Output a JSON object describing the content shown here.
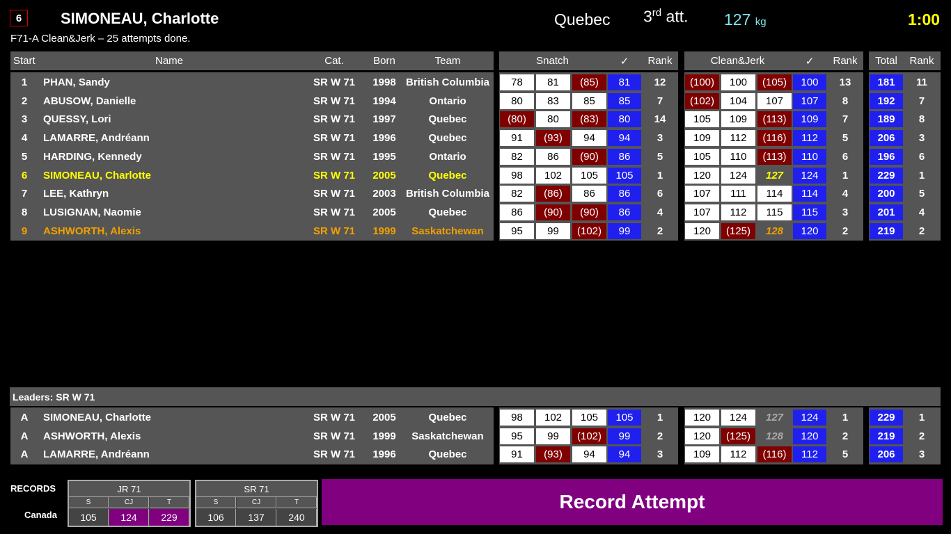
{
  "header": {
    "start_number": "6",
    "athlete_name": "SIMONEAU, Charlotte",
    "group_info": "F71-A Clean&Jerk – 25 attempts done.",
    "team": "Quebec",
    "attempt_number": "3",
    "attempt_suffix": "rd",
    "attempt_label": "att.",
    "requested_weight": "127",
    "weight_unit": "kg",
    "clock": "1:00"
  },
  "columns": {
    "start": "Start",
    "name": "Name",
    "category": "Cat.",
    "born": "Born",
    "team": "Team",
    "snatch": "Snatch",
    "best_mark": "✓",
    "rank": "Rank",
    "clean_jerk": "Clean&Jerk",
    "total": "Total"
  },
  "colors": {
    "good": "#ffffff",
    "fail": "#800000",
    "best": "#2020ee",
    "current": "#ffff00",
    "next": "#f0a000",
    "record": "#800080"
  },
  "athletes": [
    {
      "start": "1",
      "name": "PHAN, Sandy",
      "cat": "SR W 71",
      "born": "1998",
      "team": "British Columbia",
      "sn": [
        [
          "78",
          "good"
        ],
        [
          "81",
          "good"
        ],
        [
          "(85)",
          "fail"
        ]
      ],
      "sn_best": "81",
      "sn_rank": "12",
      "cj": [
        [
          "(100)",
          "fail"
        ],
        [
          "100",
          "good"
        ],
        [
          "(105)",
          "fail"
        ]
      ],
      "cj_best": "100",
      "cj_rank": "13",
      "total": "181",
      "total_rank": "11",
      "hl": ""
    },
    {
      "start": "2",
      "name": "ABUSOW, Danielle",
      "cat": "SR W 71",
      "born": "1994",
      "team": "Ontario",
      "sn": [
        [
          "80",
          "good"
        ],
        [
          "83",
          "good"
        ],
        [
          "85",
          "good"
        ]
      ],
      "sn_best": "85",
      "sn_rank": "7",
      "cj": [
        [
          "(102)",
          "fail"
        ],
        [
          "104",
          "good"
        ],
        [
          "107",
          "good"
        ]
      ],
      "cj_best": "107",
      "cj_rank": "8",
      "total": "192",
      "total_rank": "7",
      "hl": ""
    },
    {
      "start": "3",
      "name": "QUESSY, Lori",
      "cat": "SR W 71",
      "born": "1997",
      "team": "Quebec",
      "sn": [
        [
          "(80)",
          "fail"
        ],
        [
          "80",
          "good"
        ],
        [
          "(83)",
          "fail"
        ]
      ],
      "sn_best": "80",
      "sn_rank": "14",
      "cj": [
        [
          "105",
          "good"
        ],
        [
          "109",
          "good"
        ],
        [
          "(113)",
          "fail"
        ]
      ],
      "cj_best": "109",
      "cj_rank": "7",
      "total": "189",
      "total_rank": "8",
      "hl": ""
    },
    {
      "start": "4",
      "name": "LAMARRE, Andréann",
      "cat": "SR W 71",
      "born": "1996",
      "team": "Quebec",
      "sn": [
        [
          "91",
          "good"
        ],
        [
          "(93)",
          "fail"
        ],
        [
          "94",
          "good"
        ]
      ],
      "sn_best": "94",
      "sn_rank": "3",
      "cj": [
        [
          "109",
          "good"
        ],
        [
          "112",
          "good"
        ],
        [
          "(116)",
          "fail"
        ]
      ],
      "cj_best": "112",
      "cj_rank": "5",
      "total": "206",
      "total_rank": "3",
      "hl": ""
    },
    {
      "start": "5",
      "name": "HARDING, Kennedy",
      "cat": "SR W 71",
      "born": "1995",
      "team": "Ontario",
      "sn": [
        [
          "82",
          "good"
        ],
        [
          "86",
          "good"
        ],
        [
          "(90)",
          "fail"
        ]
      ],
      "sn_best": "86",
      "sn_rank": "5",
      "cj": [
        [
          "105",
          "good"
        ],
        [
          "110",
          "good"
        ],
        [
          "(113)",
          "fail"
        ]
      ],
      "cj_best": "110",
      "cj_rank": "6",
      "total": "196",
      "total_rank": "6",
      "hl": ""
    },
    {
      "start": "6",
      "name": "SIMONEAU, Charlotte",
      "cat": "SR W 71",
      "born": "2005",
      "team": "Quebec",
      "sn": [
        [
          "98",
          "good"
        ],
        [
          "102",
          "good"
        ],
        [
          "105",
          "good"
        ]
      ],
      "sn_best": "105",
      "sn_rank": "1",
      "cj": [
        [
          "120",
          "good"
        ],
        [
          "124",
          "good"
        ],
        [
          "127",
          "req"
        ]
      ],
      "cj_best": "124",
      "cj_rank": "1",
      "total": "229",
      "total_rank": "1",
      "hl": "current"
    },
    {
      "start": "7",
      "name": "LEE, Kathryn",
      "cat": "SR W 71",
      "born": "2003",
      "team": "British Columbia",
      "sn": [
        [
          "82",
          "good"
        ],
        [
          "(86)",
          "fail"
        ],
        [
          "86",
          "good"
        ]
      ],
      "sn_best": "86",
      "sn_rank": "6",
      "cj": [
        [
          "107",
          "good"
        ],
        [
          "111",
          "good"
        ],
        [
          "114",
          "good"
        ]
      ],
      "cj_best": "114",
      "cj_rank": "4",
      "total": "200",
      "total_rank": "5",
      "hl": ""
    },
    {
      "start": "8",
      "name": "LUSIGNAN, Naomie",
      "cat": "SR W 71",
      "born": "2005",
      "team": "Quebec",
      "sn": [
        [
          "86",
          "good"
        ],
        [
          "(90)",
          "fail"
        ],
        [
          "(90)",
          "fail"
        ]
      ],
      "sn_best": "86",
      "sn_rank": "4",
      "cj": [
        [
          "107",
          "good"
        ],
        [
          "112",
          "good"
        ],
        [
          "115",
          "good"
        ]
      ],
      "cj_best": "115",
      "cj_rank": "3",
      "total": "201",
      "total_rank": "4",
      "hl": ""
    },
    {
      "start": "9",
      "name": "ASHWORTH, Alexis",
      "cat": "SR W 71",
      "born": "1999",
      "team": "Saskatchewan",
      "sn": [
        [
          "95",
          "good"
        ],
        [
          "99",
          "good"
        ],
        [
          "(102)",
          "fail"
        ]
      ],
      "sn_best": "99",
      "sn_rank": "2",
      "cj": [
        [
          "120",
          "good"
        ],
        [
          "(125)",
          "fail"
        ],
        [
          "128",
          "reqnext"
        ]
      ],
      "cj_best": "120",
      "cj_rank": "2",
      "total": "219",
      "total_rank": "2",
      "hl": "next"
    }
  ],
  "leaders": {
    "title": "Leaders: SR W 71",
    "rows": [
      {
        "start": "A",
        "name": "SIMONEAU, Charlotte",
        "cat": "SR W 71",
        "born": "2005",
        "team": "Quebec",
        "sn": [
          [
            "98",
            "good"
          ],
          [
            "102",
            "good"
          ],
          [
            "105",
            "good"
          ]
        ],
        "sn_best": "105",
        "sn_rank": "1",
        "cj": [
          [
            "120",
            "good"
          ],
          [
            "124",
            "good"
          ],
          [
            "127",
            "reqdim"
          ]
        ],
        "cj_best": "124",
        "cj_rank": "1",
        "total": "229",
        "total_rank": "1",
        "hl": ""
      },
      {
        "start": "A",
        "name": "ASHWORTH, Alexis",
        "cat": "SR W 71",
        "born": "1999",
        "team": "Saskatchewan",
        "sn": [
          [
            "95",
            "good"
          ],
          [
            "99",
            "good"
          ],
          [
            "(102)",
            "fail"
          ]
        ],
        "sn_best": "99",
        "sn_rank": "2",
        "cj": [
          [
            "120",
            "good"
          ],
          [
            "(125)",
            "fail"
          ],
          [
            "128",
            "reqdim"
          ]
        ],
        "cj_best": "120",
        "cj_rank": "2",
        "total": "219",
        "total_rank": "2",
        "hl": ""
      },
      {
        "start": "A",
        "name": "LAMARRE, Andréann",
        "cat": "SR W 71",
        "born": "1996",
        "team": "Quebec",
        "sn": [
          [
            "91",
            "good"
          ],
          [
            "(93)",
            "fail"
          ],
          [
            "94",
            "good"
          ]
        ],
        "sn_best": "94",
        "sn_rank": "3",
        "cj": [
          [
            "109",
            "good"
          ],
          [
            "112",
            "good"
          ],
          [
            "(116)",
            "fail"
          ]
        ],
        "cj_best": "112",
        "cj_rank": "5",
        "total": "206",
        "total_rank": "3",
        "hl": ""
      }
    ]
  },
  "records": {
    "label": "RECORDS",
    "country": "Canada",
    "tables": [
      {
        "category": "JR 71",
        "headers": [
          "S",
          "CJ",
          "T"
        ],
        "values": [
          "105",
          "124",
          "229"
        ],
        "highlight": [
          false,
          true,
          true
        ]
      },
      {
        "category": "SR 71",
        "headers": [
          "S",
          "CJ",
          "T"
        ],
        "values": [
          "106",
          "137",
          "240"
        ],
        "highlight": [
          false,
          false,
          false
        ]
      }
    ]
  },
  "record_attempt": "Record Attempt"
}
